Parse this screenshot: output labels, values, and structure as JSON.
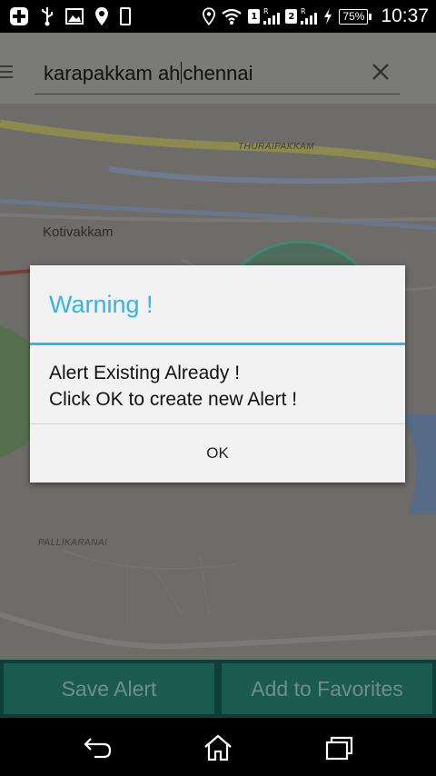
{
  "status_bar": {
    "sim1": "1",
    "sim2": "2",
    "roaming": "R",
    "battery": "75%",
    "time": "10:37"
  },
  "search": {
    "query_before_caret": "karapakkam ah",
    "query_after_caret": "chennai"
  },
  "map": {
    "labels": [
      "Kotivakkam",
      "THURAIPAKKAM",
      "PALLIKARANAI"
    ]
  },
  "dialog": {
    "title": "Warning !",
    "message_line1": "Alert Existing Already !",
    "message_line2": "Click OK to create new Alert !",
    "ok_label": "OK"
  },
  "buttons": {
    "save_alert": "Save Alert",
    "add_favorites": "Add to Favorites"
  },
  "icons": {
    "status": [
      "plus-icon",
      "usb-icon",
      "image-icon",
      "location-icon",
      "phone-icon",
      "location-icon",
      "wifi-icon",
      "signal-icon",
      "signal-icon",
      "charging-icon"
    ],
    "nav": [
      "back-icon",
      "home-icon",
      "recents-icon"
    ]
  },
  "colors": {
    "accent": "#33b5e5",
    "bottom_bar": "#0b3f37",
    "button": "#1a5a4f"
  }
}
